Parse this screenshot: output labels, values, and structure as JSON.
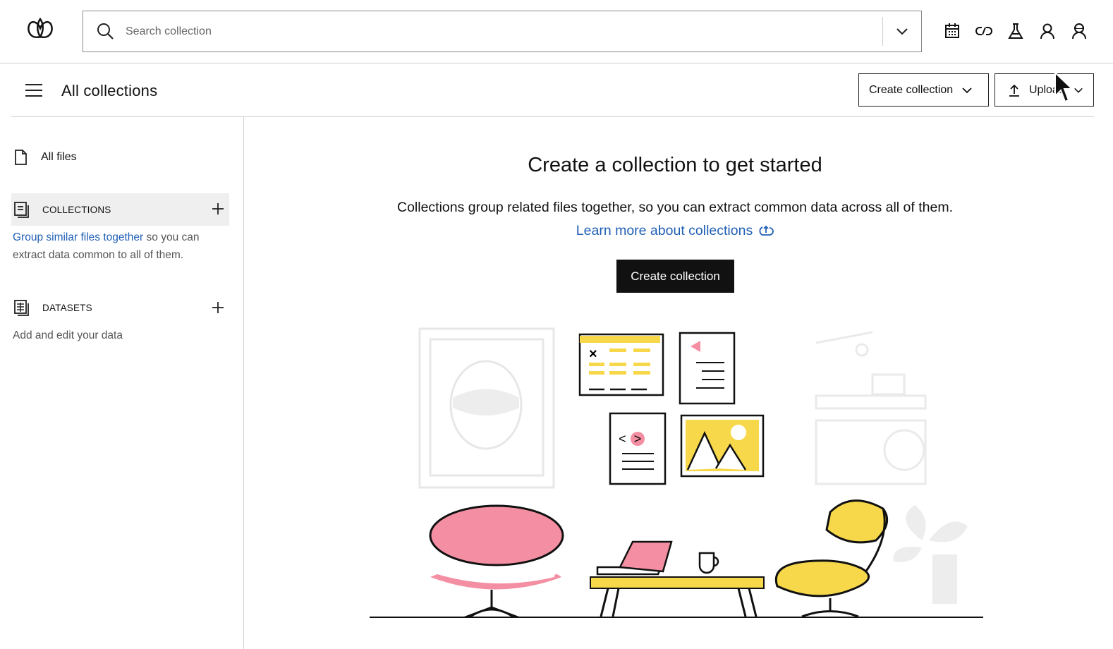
{
  "search": {
    "placeholder": "Search collection"
  },
  "header": {
    "title": "All collections",
    "create_collection_label": "Create collection",
    "upload_label": "Upload"
  },
  "sidebar": {
    "all_files_label": "All files",
    "collections_label": "COLLECTIONS",
    "collections_link": "Group similar files together",
    "collections_desc": " so you can extract data common to all of them.",
    "datasets_label": "DATASETS",
    "datasets_desc": "Add and edit your data"
  },
  "main": {
    "title": "Create a collection to get started",
    "subtitle": "Collections group related files together, so you can extract common data across all of them.",
    "learn_more": "Learn more about collections",
    "cta_label": "Create collection"
  },
  "icons": {
    "top": [
      "calendar-icon",
      "link-icon",
      "flask-icon",
      "user-icon",
      "agent-icon"
    ]
  },
  "colors": {
    "accent_link": "#1f5fb5",
    "primary_button": "#111111",
    "illustration_pink": "#f48fa3",
    "illustration_yellow": "#f7d84a"
  }
}
